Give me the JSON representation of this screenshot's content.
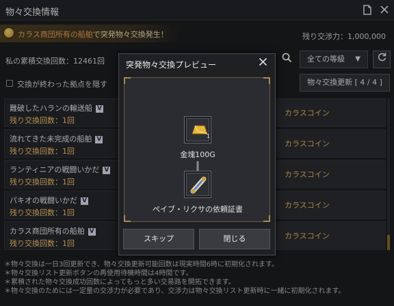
{
  "window": {
    "title": "物々交換情報"
  },
  "banner": {
    "prefix": "カラス商団所有の船舶",
    "suffix": "で突発物々交換発生！",
    "remaining_energy": "残り交渉力：1,000,000"
  },
  "filters": {
    "cumulative": "私の累積交換回数：12461回",
    "grade_selected": "全ての等級",
    "hide_label": "交換が終わった拠点を隠す",
    "update_button": "物々交換更新 [ 4 / 4 ]"
  },
  "list": [
    {
      "name": "難破したハランの輸送船",
      "remaining": "残り交換回数：1回",
      "reward": "カラスコイン"
    },
    {
      "name": "流れてきた未完成の船舶",
      "remaining": "残り交換回数：1回",
      "reward": "カラスコイン"
    },
    {
      "name": "ランティニアの戦闘いかだ",
      "remaining": "残り交換回数：1回",
      "reward": "カラスコイン"
    },
    {
      "name": "パキオの戦闘いかだ",
      "remaining": "残り交換回数：1回",
      "reward": "カラスコイン"
    },
    {
      "name": "カラス商団所有の船舶",
      "remaining": "残り交換回数：1回",
      "reward": "カラスコイン"
    }
  ],
  "badge_text": "V",
  "notes": [
    "＊物々交換は一日3回更新でき、物々交換更新可能回数は現実時間6時に初期化されます。",
    "＊物々交換リスト更新ボタンの再使用待機時間は4時間です。",
    "＊累積された物々交換成功回数によってもっと多い交易路を開拓できます。",
    "＊物々交換のためには一定量の交渉力が必要であり、交渉力は物々交換リスト更新時に一緒に初期化されます。"
  ],
  "modal": {
    "title": "突発物々交換プレビュー",
    "give_item": "金塊100G",
    "give_count": "1",
    "receive_item": "ペイブ・リクサの依頼証書",
    "skip_button": "スキップ",
    "close_button": "閉じる"
  },
  "colors": {
    "accent_gold": "#e3b55a",
    "remaining_yellow": "#f0c070",
    "banner_orange": "#e7a05a"
  },
  "icons": [
    "document-icon",
    "close-icon",
    "search-icon",
    "chevron-down-icon",
    "refresh-icon",
    "gold-bar-icon",
    "scroll-icon",
    "arrow-down-icon",
    "coin-icon"
  ]
}
